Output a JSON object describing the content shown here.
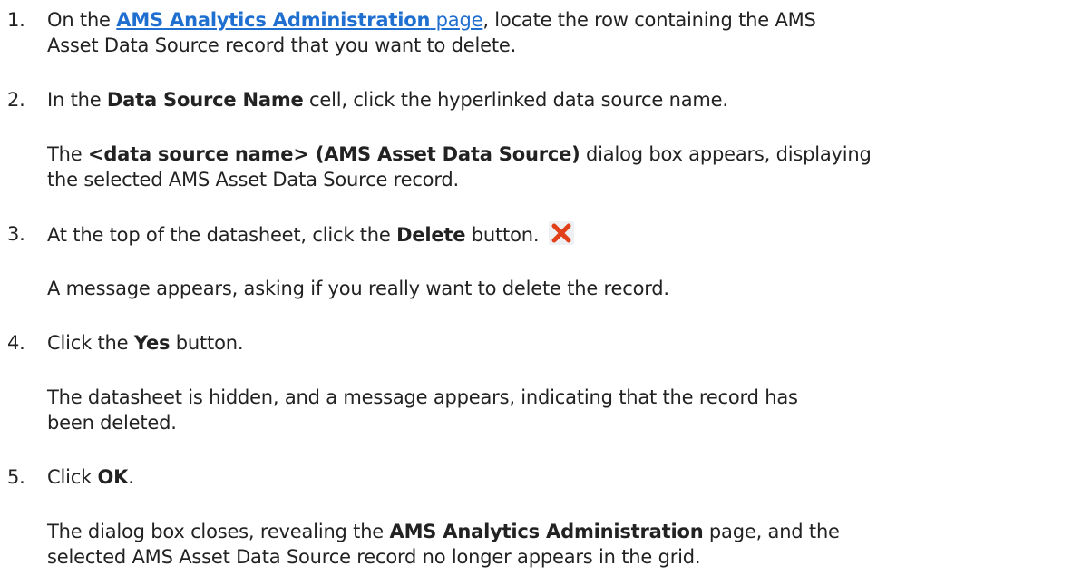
{
  "steps": [
    {
      "number": "1.",
      "line1": {
        "pre": "On the ",
        "link_bold": "AMS Analytics Administration",
        "link_plain": " page",
        "post": ", locate the row containing the AMS"
      },
      "line2": "Asset Data Source record that you want to delete."
    },
    {
      "number": "2.",
      "pre": "In the ",
      "bold": "Data Source Name",
      "post": " cell, click the hyperlinked data source name.",
      "result": {
        "pre": "The ",
        "bold": "<data source name> (AMS Asset Data Source)",
        "post": " dialog box appears, displaying",
        "line2": "the selected AMS Asset Data Source record."
      }
    },
    {
      "number": "3.",
      "pre": "At the top of the datasheet, click the ",
      "bold": "Delete",
      "post": " button.",
      "icon": "delete-x-icon",
      "icon_color": "#e2401a",
      "result": "A message appears, asking if you really want to delete the record."
    },
    {
      "number": "4.",
      "pre": "Click the ",
      "bold": "Yes",
      "post": " button.",
      "result": {
        "line1": "The datasheet is hidden, and a message appears, indicating that the record has",
        "line2": "been deleted."
      }
    },
    {
      "number": "5.",
      "pre": "Click ",
      "bold": "OK",
      "post": ".",
      "result": {
        "pre": "The dialog box closes, revealing the ",
        "bold": "AMS Analytics Administration",
        "post": " page, and the",
        "line2": "selected AMS Asset Data Source record no longer appears in the grid."
      }
    }
  ]
}
